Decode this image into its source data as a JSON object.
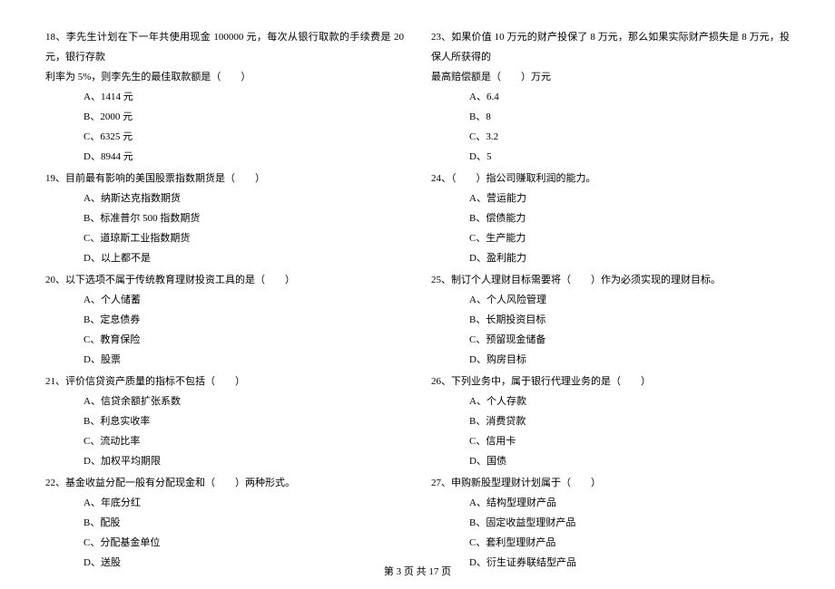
{
  "left": {
    "q18": {
      "line1": "18、李先生计划在下一年共使用现金 100000 元，每次从银行取款的手续费是 20 元，银行存款",
      "line2": "利率为 5%，则李先生的最佳取款额是（　　）",
      "a": "A、1414 元",
      "b": "B、2000 元",
      "c": "C、6325 元",
      "d": "D、8944 元"
    },
    "q19": {
      "text": "19、目前最有影响的美国股票指数期货是（　　）",
      "a": "A、纳斯达克指数期货",
      "b": "B、标准普尔 500 指数期货",
      "c": "C、道琼斯工业指数期货",
      "d": "D、以上都不是"
    },
    "q20": {
      "text": "20、以下选项不属于传统教育理财投资工具的是（　　）",
      "a": "A、个人储蓄",
      "b": "B、定息债券",
      "c": "C、教育保险",
      "d": "D、股票"
    },
    "q21": {
      "text": "21、评价信贷资产质量的指标不包括（　　）",
      "a": "A、信贷余额扩张系数",
      "b": "B、利息实收率",
      "c": "C、流动比率",
      "d": "D、加权平均期限"
    },
    "q22": {
      "text": "22、基金收益分配一般有分配现金和（　　）两种形式。",
      "a": "A、年底分红",
      "b": "B、配股",
      "c": "C、分配基金单位",
      "d": "D、送股"
    }
  },
  "right": {
    "q23": {
      "line1": "23、如果价值 10 万元的财产投保了 8 万元，那么如果实际财产损失是 8 万元，投保人所获得的",
      "line2": "最高赔偿额是（　　）万元",
      "a": "A、6.4",
      "b": "B、8",
      "c": "C、3.2",
      "d": "D、5"
    },
    "q24": {
      "text": "24、（　　）指公司赚取利润的能力。",
      "a": "A、营运能力",
      "b": "B、偿债能力",
      "c": "C、生产能力",
      "d": "D、盈利能力"
    },
    "q25": {
      "text": "25、制订个人理财目标需要将（　　）作为必须实现的理财目标。",
      "a": "A、个人风险管理",
      "b": "B、长期投资目标",
      "c": "C、预留现金储备",
      "d": "D、购房目标"
    },
    "q26": {
      "text": "26、下列业务中，属于银行代理业务的是（　　）",
      "a": "A、个人存款",
      "b": "B、消费贷款",
      "c": "C、信用卡",
      "d": "D、国债"
    },
    "q27": {
      "text": "27、申购新股型理财计划属于（　　）",
      "a": "A、结构型理财产品",
      "b": "B、固定收益型理财产品",
      "c": "C、套利型理财产品",
      "d": "D、衍生证券联结型产品"
    }
  },
  "footer": "第 3 页 共 17 页"
}
